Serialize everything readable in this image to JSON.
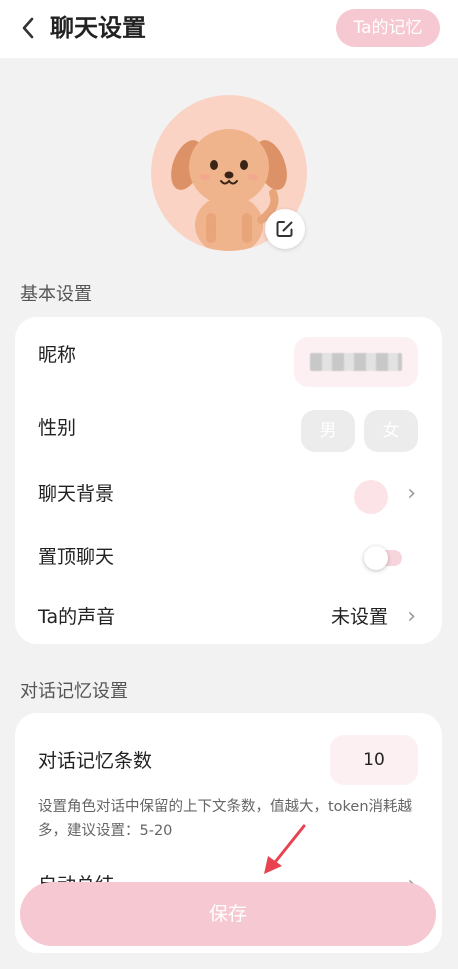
{
  "header": {
    "title": "聊天设置",
    "memory_button": "Ta的记忆"
  },
  "sections": {
    "basic_title": "基本设置",
    "memory_title": "对话记忆设置"
  },
  "basic": {
    "nickname_label": "昵称",
    "gender_label": "性别",
    "gender_male": "男",
    "gender_female": "女",
    "background_label": "聊天背景",
    "pin_label": "置顶聊天",
    "pin_enabled": false,
    "voice_label": "Ta的声音",
    "voice_value": "未设置"
  },
  "memory": {
    "count_label": "对话记忆条数",
    "count_value": "10",
    "hint": "设置角色对话中保留的上下文条数，值越大，token消耗越多，建议设置：5-20",
    "auto_summary_label": "自动总结"
  },
  "footer": {
    "save_label": "保存"
  },
  "colors": {
    "accent": "#f6c8d2",
    "avatar_bg": "#fad3c4",
    "arrow": "#e8434f"
  },
  "icons": {
    "back": "chevron-left-icon",
    "edit": "edit-icon",
    "chevron": "chevron-right-icon",
    "pointer": "red-arrow-icon"
  }
}
